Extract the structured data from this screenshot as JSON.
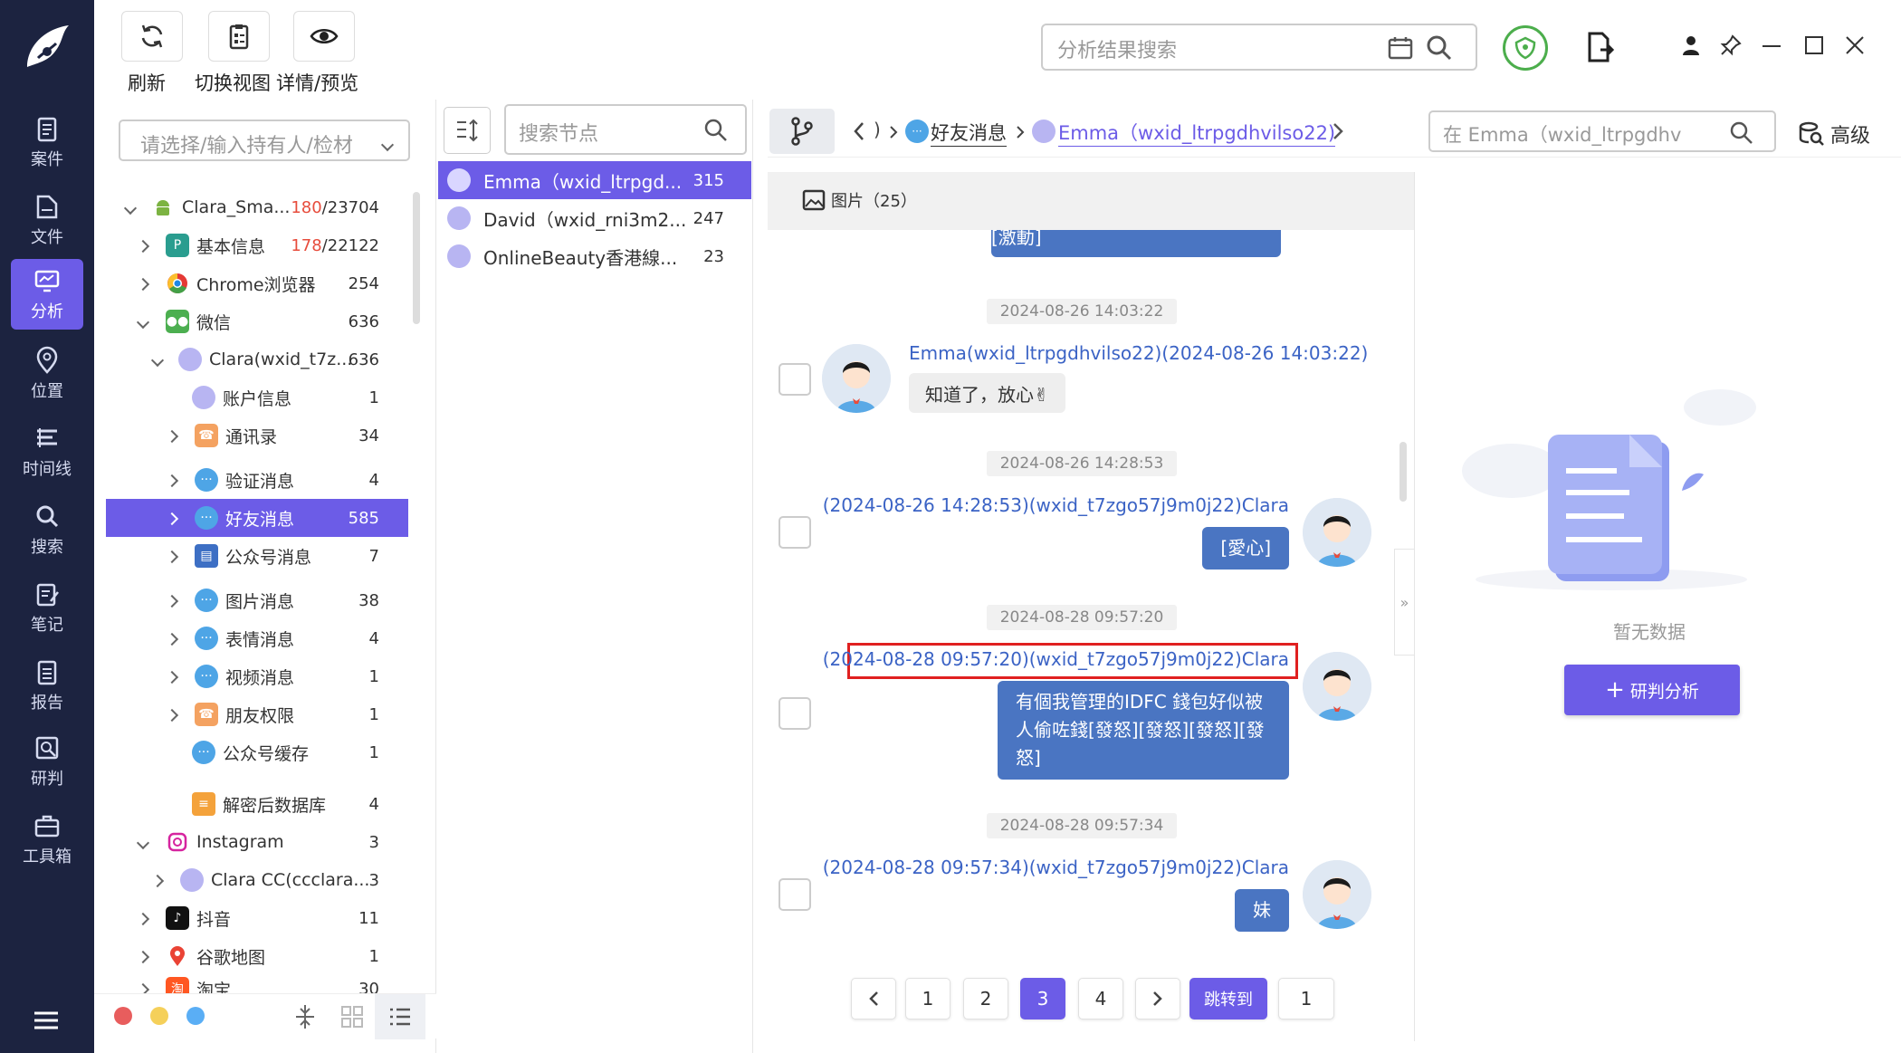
{
  "sidebar": {
    "items": [
      {
        "label": "案件",
        "icon": "clipboard-icon"
      },
      {
        "label": "文件",
        "icon": "file-icon"
      },
      {
        "label": "分析",
        "icon": "monitor-icon"
      },
      {
        "label": "位置",
        "icon": "location-pin-icon"
      },
      {
        "label": "时间线",
        "icon": "timeline-icon"
      },
      {
        "label": "搜索",
        "icon": "search-icon"
      },
      {
        "label": "笔记",
        "icon": "note-icon"
      },
      {
        "label": "报告",
        "icon": "report-icon"
      },
      {
        "label": "研判",
        "icon": "judge-icon"
      },
      {
        "label": "工具箱",
        "icon": "toolbox-icon"
      }
    ]
  },
  "toolbar": {
    "refresh": "刷新",
    "switch_view": "切换视图",
    "detail_preview": "详情/预览"
  },
  "top_search": {
    "placeholder": "分析结果搜索"
  },
  "owner_select": {
    "placeholder": "请选择/输入持有人/检材"
  },
  "tree": [
    {
      "label": "Clara_Sma...",
      "count_red": "180",
      "count": "/23704"
    },
    {
      "label": "基本信息",
      "count_red": "178",
      "count": "/22122"
    },
    {
      "label": "Chrome浏览器",
      "count": "254"
    },
    {
      "label": "微信",
      "count": "636"
    },
    {
      "label": "Clara(wxid_t7z...",
      "count": "636"
    },
    {
      "label": "账户信息",
      "count": "1"
    },
    {
      "label": "通讯录",
      "count": "34"
    },
    {
      "label": "验证消息",
      "count": "4"
    },
    {
      "label": "好友消息",
      "count": "585"
    },
    {
      "label": "公众号消息",
      "count": "7"
    },
    {
      "label": "图片消息",
      "count": "38"
    },
    {
      "label": "表情消息",
      "count": "4"
    },
    {
      "label": "视频消息",
      "count": "1"
    },
    {
      "label": "朋友权限",
      "count": "1"
    },
    {
      "label": "公众号缓存",
      "count": "1"
    },
    {
      "label": "解密后数据库",
      "count": "4"
    },
    {
      "label": "Instagram",
      "count": "3"
    },
    {
      "label": "Clara CC(ccclara...",
      "count": "3"
    },
    {
      "label": "抖音",
      "count": "11"
    },
    {
      "label": "谷歌地图",
      "count": "1"
    },
    {
      "label": "淘宝",
      "count": "30"
    }
  ],
  "node_search": {
    "placeholder": "搜索节点"
  },
  "contacts": [
    {
      "name": "Emma（wxid_ltrpgd...",
      "count": "315"
    },
    {
      "name": "David（wxid_rni3m2...",
      "count": "247"
    },
    {
      "name": "OnlineBeauty香港線...",
      "count": "23"
    }
  ],
  "breadcrumb": {
    "sep": ")",
    "friend_msgs": "好友消息",
    "contact": "Emma（wxid_ltrpgdhvilso22)"
  },
  "chat_search": {
    "placeholder": "在 Emma（wxid_ltrpgdhv"
  },
  "advanced": "高级",
  "images_tab": "图片（25）",
  "top_bubble_text": "[激動]",
  "messages": [
    {
      "time": "2024-08-26 14:03:22",
      "sender": "Emma(wxid_ltrpgdhvilso22)(2024-08-26 14:03:22)",
      "text": "知道了，放心✌"
    },
    {
      "time": "2024-08-26 14:28:53",
      "sender": "(2024-08-26 14:28:53)(wxid_t7zgo57j9m0j22)Clara",
      "text": "[愛心]"
    },
    {
      "time": "2024-08-28 09:57:20",
      "sender": "(2024-08-28 09:57:20)(wxid_t7zgo57j9m0j22)Clara",
      "text": "有個我管理的IDFC 錢包好似被人偷咗錢[發怒][發怒][發怒][發怒]"
    },
    {
      "time": "2024-08-28 09:57:34",
      "sender": "(2024-08-28 09:57:34)(wxid_t7zgo57j9m0j22)Clara",
      "text": "妹"
    }
  ],
  "pagination": {
    "pages": [
      "1",
      "2",
      "3",
      "4"
    ],
    "current": "3",
    "jump_label": "跳转到",
    "jump_value": "1"
  },
  "right_panel": {
    "empty_text": "暂无数据",
    "button": "研判分析",
    "button_prefix": "+"
  },
  "colors": {
    "accent": "#6c5ce7",
    "sidebar": "#1c2340",
    "bubble_right": "#4a75c2",
    "link": "#3b63c5",
    "highlight_border": "#e02020"
  }
}
